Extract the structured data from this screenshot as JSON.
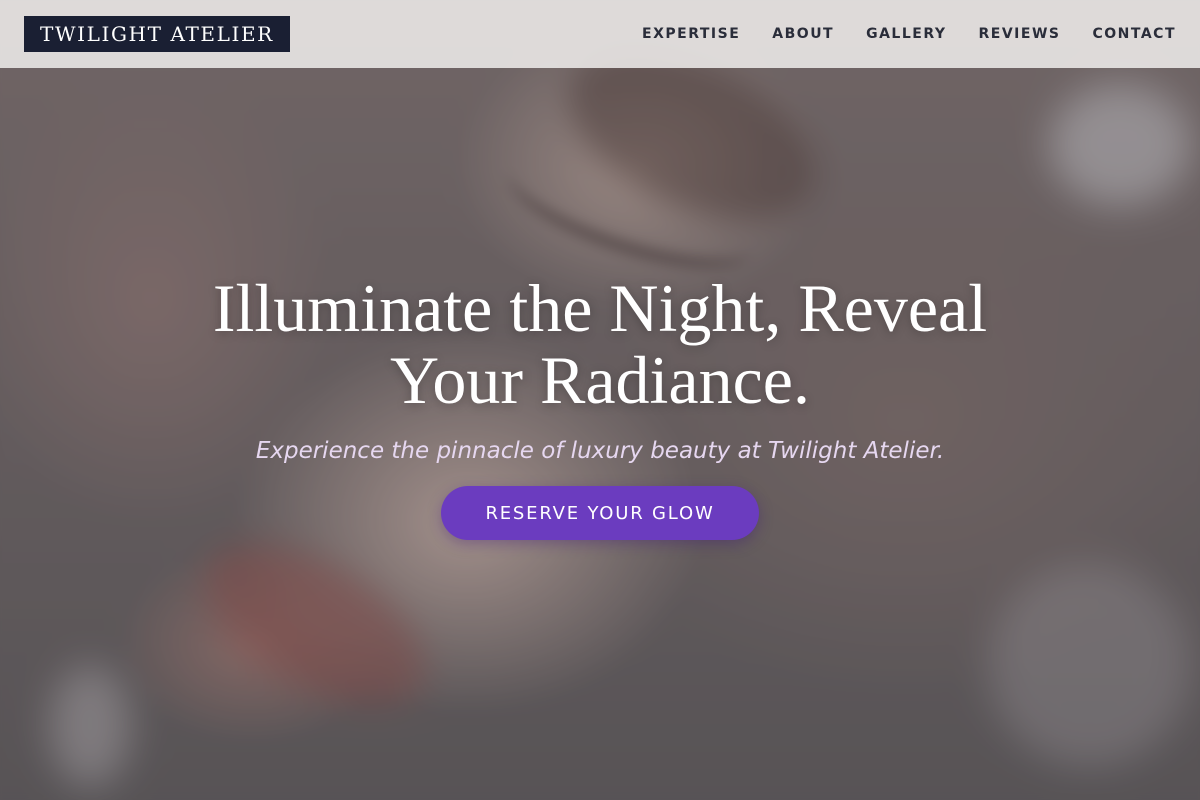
{
  "brand": {
    "logo_text": "TWILIGHT ATELIER"
  },
  "nav": {
    "items": [
      {
        "label": "EXPERTISE"
      },
      {
        "label": "ABOUT"
      },
      {
        "label": "GALLERY"
      },
      {
        "label": "REVIEWS"
      },
      {
        "label": "CONTACT"
      }
    ]
  },
  "hero": {
    "headline": "Illuminate the Night, Reveal Your Radiance.",
    "subheadline": "Experience the pinnacle of luxury beauty at Twilight Atelier.",
    "cta_label": "RESERVE YOUR GLOW"
  },
  "colors": {
    "logo_bg": "#1a1f33",
    "accent": "#6b3cbf",
    "subheadline": "#e6d7f0",
    "nav_text": "#2a2d3a"
  }
}
